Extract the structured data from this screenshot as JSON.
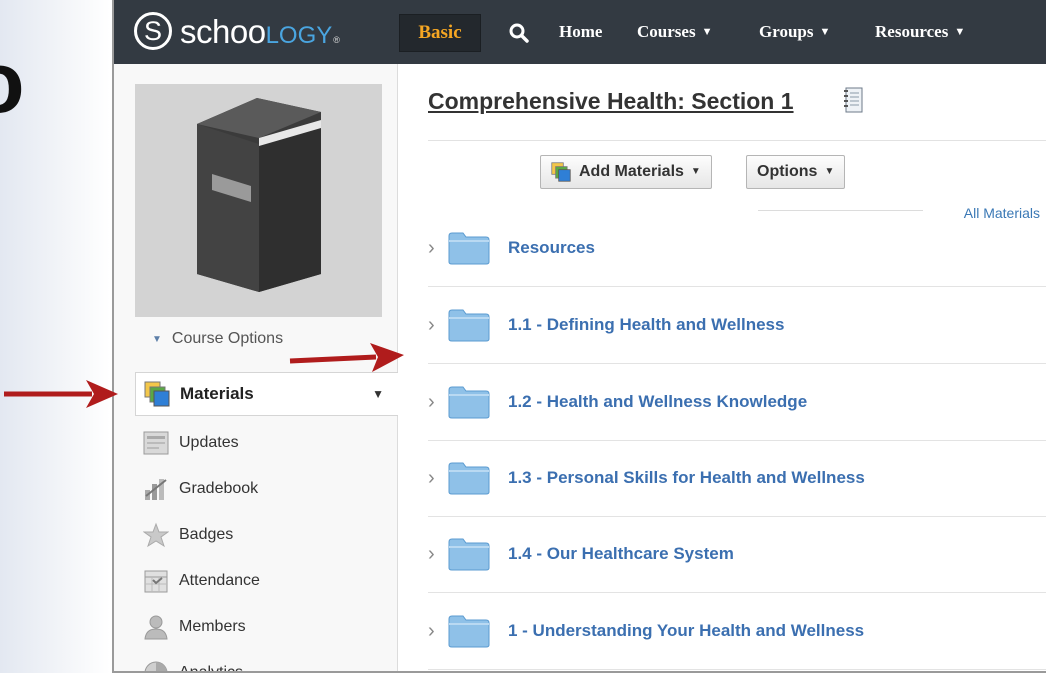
{
  "cut_text": "o",
  "header": {
    "logo_mark": "S",
    "logo_word_prefix": "schoo",
    "logo_word_suffix": "logy",
    "logo_tm": "®",
    "basic_label": "Basic",
    "nav": [
      {
        "label": "Home",
        "caret": ""
      },
      {
        "label": "Courses",
        "caret": "▼"
      },
      {
        "label": "Groups",
        "caret": "▼"
      },
      {
        "label": "Resources",
        "caret": "▼"
      }
    ]
  },
  "sidebar": {
    "course_options_label": "Course Options",
    "items": [
      {
        "label": "Materials",
        "icon": "materials-icon",
        "active": true
      },
      {
        "label": "Updates",
        "icon": "updates-icon"
      },
      {
        "label": "Gradebook",
        "icon": "gradebook-icon"
      },
      {
        "label": "Badges",
        "icon": "badges-icon"
      },
      {
        "label": "Attendance",
        "icon": "attendance-icon"
      },
      {
        "label": "Members",
        "icon": "members-icon"
      },
      {
        "label": "Analytics",
        "icon": "analytics-icon"
      }
    ]
  },
  "main": {
    "title": "Comprehensive Health: Section 1",
    "add_materials_label": "Add Materials",
    "options_label": "Options",
    "filter_label": "All Materials",
    "folders": [
      "Resources",
      "1.1 - Defining Health and Wellness",
      "1.2 - Health and Wellness Knowledge",
      "1.3 - Personal Skills for Health and Wellness",
      "1.4 - Our Healthcare System",
      "1 - Understanding Your Health and Wellness"
    ]
  },
  "colors": {
    "header_bg": "#333a42",
    "basic_text": "#f5a623",
    "logo_accent": "#4aa5e0",
    "link_blue": "#3b6fb0",
    "arrow_red": "#b01c1c"
  }
}
